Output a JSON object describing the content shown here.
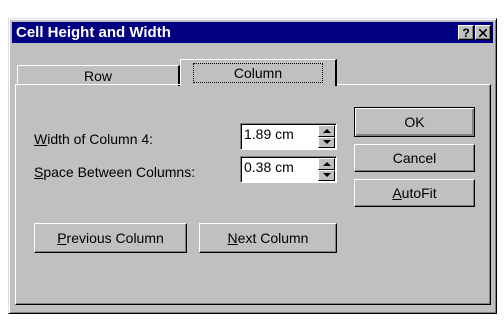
{
  "window": {
    "title": "Cell Height and Width",
    "help_glyph": "?",
    "close_glyph": "✕"
  },
  "tabs": [
    {
      "label": "Row",
      "active": false
    },
    {
      "label": "Column",
      "active": true
    }
  ],
  "fields": {
    "width_label_accel": "W",
    "width_label_rest": "idth of Column 4:",
    "width_value": "1.89 cm",
    "space_label_accel": "S",
    "space_label_rest": "pace Between Columns:",
    "space_value": "0.38 cm"
  },
  "buttons": {
    "ok": "OK",
    "cancel": "Cancel",
    "autofit_accel": "A",
    "autofit_rest": "utoFit",
    "prev_accel": "P",
    "prev_rest": "revious Column",
    "next_accel": "N",
    "next_rest": "ext Column"
  },
  "colors": {
    "titlebar": "#000080",
    "face": "#c0c0c0"
  }
}
